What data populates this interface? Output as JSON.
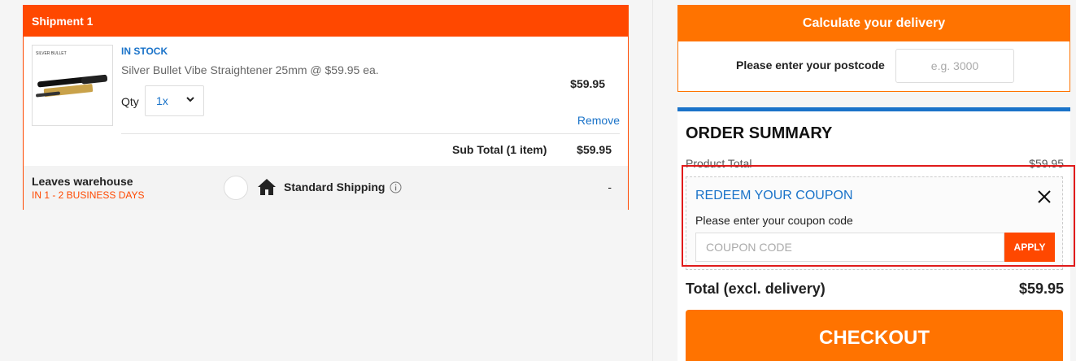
{
  "shipment": {
    "title": "Shipment 1",
    "item": {
      "stock_status": "IN STOCK",
      "name": "Silver Bullet Vibe Straightener 25mm @ $59.95 ea.",
      "image_brand": "SILVER BULLET",
      "qty_label": "Qty",
      "qty_value": "1x",
      "price": "$59.95",
      "remove_label": "Remove"
    },
    "subtotal_label": "Sub Total (1 item)",
    "subtotal_value": "$59.95",
    "shipping": {
      "warehouse_label": "Leaves warehouse",
      "eta": "IN 1 - 2 BUSINESS DAYS",
      "method": "Standard Shipping",
      "cost": "-"
    }
  },
  "delivery": {
    "title": "Calculate your delivery",
    "postcode_label": "Please enter your postcode",
    "postcode_placeholder": "e.g. 3000"
  },
  "summary": {
    "title": "ORDER SUMMARY",
    "product_total_label": "Product Total",
    "product_total_value": "$59.95",
    "coupon": {
      "title": "REDEEM YOUR COUPON",
      "label": "Please enter your coupon code",
      "placeholder": "COUPON CODE",
      "apply_label": "APPLY"
    },
    "total_label": "Total (excl. delivery)",
    "total_value": "$59.95",
    "checkout_label": "CHECKOUT"
  },
  "colors": {
    "brand_orange": "#ff4800",
    "delivery_orange": "#ff7300",
    "link_blue": "#1a73c9",
    "highlight_red": "#e01b1b"
  }
}
